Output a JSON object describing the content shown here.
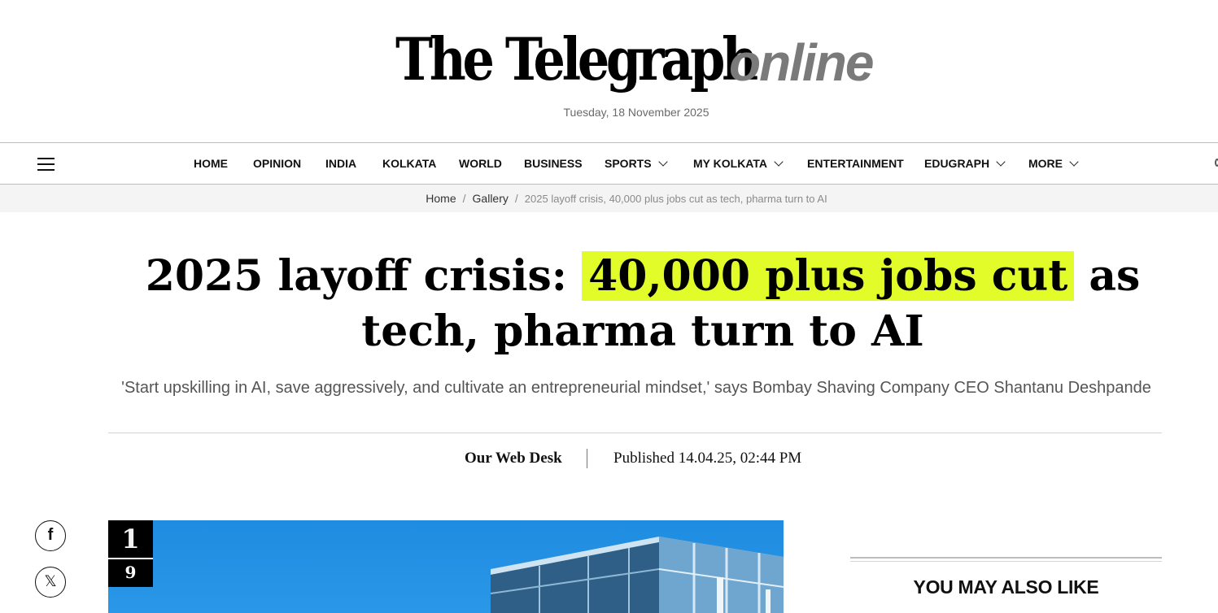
{
  "masthead": {
    "title": "The Telegraph",
    "title_suffix": "online",
    "date": "Tuesday, 18 November 2025"
  },
  "nav": {
    "items": [
      "HOME",
      "OPINION",
      "INDIA",
      "KOLKATA",
      "WORLD",
      "BUSINESS",
      "SPORTS",
      "MY KOLKATA",
      "ENTERTAINMENT",
      "EDUGRAPH",
      "MORE"
    ],
    "dropdown_items": [
      "SPORTS",
      "MY KOLKATA",
      "EDUGRAPH",
      "MORE"
    ],
    "menu_icon": "hamburger-menu-icon"
  },
  "breadcrumb": {
    "items": [
      "Home",
      "Gallery"
    ],
    "current": "2025 layoff crisis, 40,000 plus jobs cut as tech, pharma turn to AI"
  },
  "article": {
    "headline_pre": "2025 layoff crisis: ",
    "headline_highlight": "40,000 plus jobs cut",
    "headline_post": " as tech, pharma turn to AI",
    "highlight_color": "#e2fc2a",
    "standfirst": "'Start upskilling in AI, save aggressively, and cultivate an entrepreneurial mindset,' says Bombay Shaving Company CEO Shantanu Deshpande",
    "author": "Our Web Desk",
    "published": "Published 14.04.25, 02:44 PM"
  },
  "social": {
    "facebook_label": "f",
    "x_label": "𝕏"
  },
  "gallery": {
    "current": "1",
    "total": "9"
  },
  "sidebar": {
    "heading": "YOU MAY ALSO LIKE"
  }
}
